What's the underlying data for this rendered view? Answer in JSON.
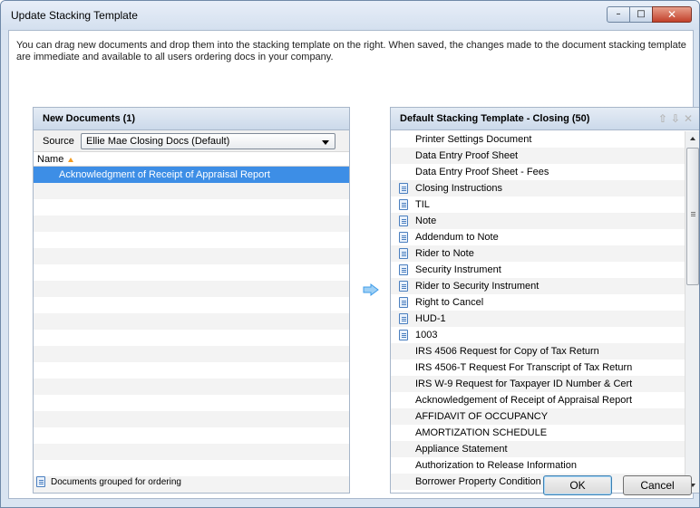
{
  "window": {
    "title": "Update Stacking Template",
    "min_glyph": "–",
    "max_glyph": "□",
    "close_glyph": "✕"
  },
  "intro_text": "You can drag new documents and drop them into the stacking template on the right. When saved, the changes made to the document stacking template are immediate and available to all users ordering docs in your company.",
  "left_panel": {
    "title": "New Documents (1)",
    "source_label": "Source",
    "source_value": "Ellie Mae Closing Docs (Default)",
    "column_name": "Name",
    "items": [
      "Acknowledgment of Receipt of Appraisal Report"
    ],
    "selected_index": 0,
    "empty_rows": 19
  },
  "right_panel": {
    "title": "Default Stacking Template - Closing (50)",
    "items": [
      {
        "label": "Printer Settings Document",
        "grouped": false
      },
      {
        "label": "Data Entry Proof Sheet",
        "grouped": false
      },
      {
        "label": "Data Entry Proof Sheet - Fees",
        "grouped": false
      },
      {
        "label": "Closing Instructions",
        "grouped": true
      },
      {
        "label": "TIL",
        "grouped": true
      },
      {
        "label": "Note",
        "grouped": true
      },
      {
        "label": "Addendum to Note",
        "grouped": true
      },
      {
        "label": "Rider to Note",
        "grouped": true
      },
      {
        "label": "Security Instrument",
        "grouped": true
      },
      {
        "label": "Rider to Security Instrument",
        "grouped": true
      },
      {
        "label": "Right to Cancel",
        "grouped": true
      },
      {
        "label": "HUD-1",
        "grouped": true
      },
      {
        "label": "1003",
        "grouped": true
      },
      {
        "label": "IRS 4506 Request for Copy of Tax Return",
        "grouped": false
      },
      {
        "label": "IRS 4506-T Request For Transcript of Tax Return",
        "grouped": false
      },
      {
        "label": "IRS W-9 Request for Taxpayer ID Number & Cert",
        "grouped": false
      },
      {
        "label": "Acknowledgement of Receipt of Appraisal Report",
        "grouped": false
      },
      {
        "label": "AFFIDAVIT OF OCCUPANCY",
        "grouped": false
      },
      {
        "label": "AMORTIZATION  SCHEDULE",
        "grouped": false
      },
      {
        "label": "Appliance Statement",
        "grouped": false
      },
      {
        "label": "Authorization to Release Information",
        "grouped": false
      },
      {
        "label": "Borrower Property Condition Certification",
        "grouped": false
      }
    ],
    "move_up_glyph": "⇧",
    "move_down_glyph": "⇩",
    "remove_glyph": "✕"
  },
  "footer": {
    "legend_text": "Documents grouped for ordering",
    "ok_label": "OK",
    "cancel_label": "Cancel"
  },
  "colors": {
    "selection": "#3d8ee6",
    "accent_arrow": "#3d9be9",
    "close_button": "#c2402a"
  }
}
